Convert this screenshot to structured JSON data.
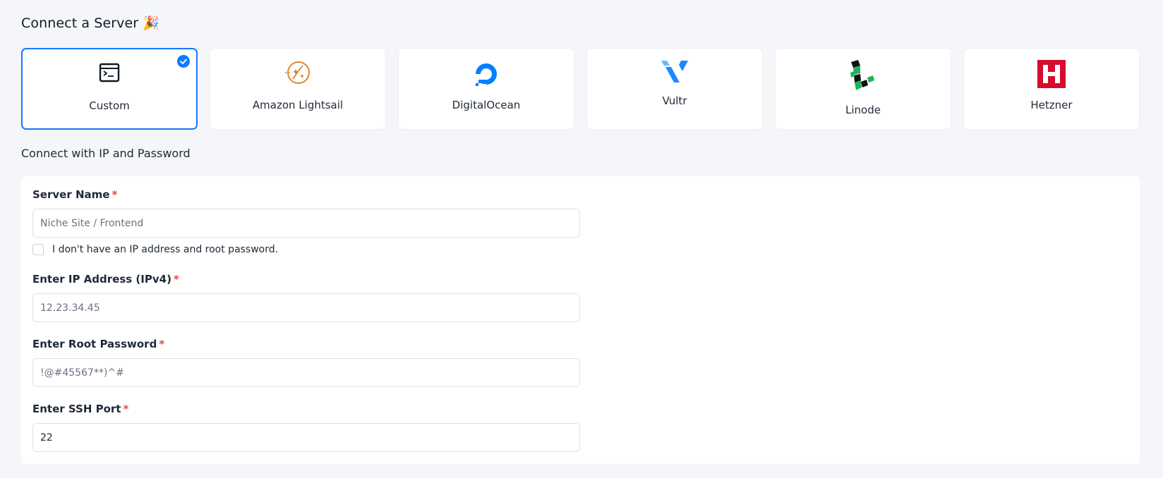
{
  "page": {
    "title": "Connect a Server",
    "title_emoji": "🎉"
  },
  "providers": [
    {
      "label": "Custom",
      "icon": "terminal-icon",
      "selected": true
    },
    {
      "label": "Amazon Lightsail",
      "icon": "amazon-lightsail-icon",
      "selected": false
    },
    {
      "label": "DigitalOcean",
      "icon": "digitalocean-icon",
      "selected": false
    },
    {
      "label": "Vultr",
      "icon": "vultr-icon",
      "selected": false
    },
    {
      "label": "Linode",
      "icon": "linode-icon",
      "selected": false
    },
    {
      "label": "Hetzner",
      "icon": "hetzner-icon",
      "selected": false
    }
  ],
  "section": {
    "title": "Connect with IP and Password"
  },
  "form": {
    "server_name": {
      "label": "Server Name",
      "required_mark": "*",
      "placeholder": "Niche Site / Frontend",
      "value": ""
    },
    "no_ip_checkbox": {
      "label": "I don't have an IP address and root password.",
      "checked": false
    },
    "ip_address": {
      "label": "Enter IP Address (IPv4)",
      "required_mark": "*",
      "placeholder": "12.23.34.45",
      "value": ""
    },
    "root_password": {
      "label": "Enter Root Password",
      "required_mark": "*",
      "placeholder": "!@#45567**)^#",
      "value": ""
    },
    "ssh_port": {
      "label": "Enter SSH Port",
      "required_mark": "*",
      "placeholder": "",
      "value": "22"
    }
  },
  "colors": {
    "accent": "#147aff",
    "required": "#ef4444",
    "lightsail_orange": "#e07a1f",
    "digitalocean_blue": "#0080ff",
    "vultr_blue": "#1e88ff",
    "linode_green": "#1fb25a",
    "hetzner_red": "#d50c2d",
    "background": "#f4f6f9"
  }
}
